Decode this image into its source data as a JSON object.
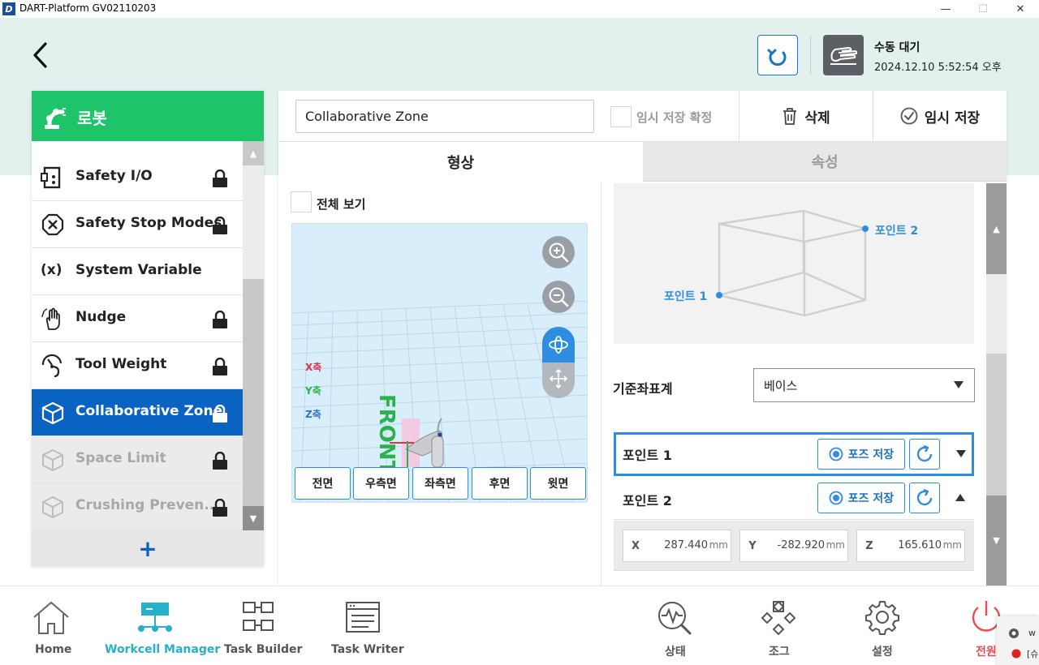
{
  "window": {
    "logo": "D",
    "title": "DART-Platform GV02110203",
    "min": "—",
    "max": "☐",
    "close": "✕"
  },
  "header": {
    "status_title": "수동 대기",
    "status_time": "2024.12.10 5:52:54 오후"
  },
  "sidebar": {
    "title": "로봇",
    "items": [
      {
        "label": "Safety I/O",
        "icon": "safety-io-icon",
        "locked": true,
        "state": "normal"
      },
      {
        "label": "Safety Stop Modes",
        "icon": "stop-mode-icon",
        "locked": true,
        "state": "normal"
      },
      {
        "label": "System Variable",
        "icon": "variable-icon",
        "locked": false,
        "state": "normal"
      },
      {
        "label": "Nudge",
        "icon": "nudge-hand-icon",
        "locked": true,
        "state": "normal"
      },
      {
        "label": "Tool Weight",
        "icon": "tool-weight-icon",
        "locked": true,
        "state": "normal"
      },
      {
        "label": "Collaborative Zone",
        "icon": "cube-icon",
        "locked": true,
        "state": "active"
      },
      {
        "label": "Space Limit",
        "icon": "cube-icon",
        "locked": true,
        "state": "disabled"
      },
      {
        "label": "Crushing Preven...",
        "icon": "cube-icon",
        "locked": true,
        "state": "disabled"
      }
    ],
    "add_label": "+",
    "variable_glyph": "(x)"
  },
  "editor": {
    "zone_name": "Collaborative Zone",
    "temp_confirm_label": "임시 저장 확정",
    "delete_label": "삭제",
    "temp_save_label": "임시 저장",
    "tabs": {
      "shape": "형상",
      "properties": "속성"
    },
    "full_view_label": "전체 보기",
    "axes": {
      "x": "X축",
      "y": "Y축",
      "z": "Z축"
    },
    "front_text": "FRONT",
    "view_buttons": [
      "전면",
      "우측면",
      "좌측면",
      "후면",
      "윗면"
    ],
    "diagram_point1": "포인트 1",
    "diagram_point2": "포인트 2",
    "coord_label": "기준좌표계",
    "coord_value": "베이스",
    "point1": {
      "label": "포인트 1",
      "pose_btn": "포즈 저장"
    },
    "point2": {
      "label": "포인트 2",
      "pose_btn": "포즈 저장",
      "x_axis": "X",
      "x_value": "287.440",
      "y_axis": "Y",
      "y_value": "-282.920",
      "z_axis": "Z",
      "z_value": "165.610",
      "unit": "mm"
    }
  },
  "bottom_nav": {
    "home": "Home",
    "workcell": "Workcell Manager",
    "task_builder": "Task Builder",
    "task_writer": "Task Writer",
    "status": "상태",
    "jog": "조그",
    "settings": "설정",
    "power": "전원"
  },
  "popup": {
    "line1": "w",
    "line2": "[슈"
  },
  "colors": {
    "accent": "#0a63c2",
    "green": "#1ec46a",
    "header_bg": "#e3f1ee",
    "highlight_blue": "#2e8de0",
    "power_red": "#e84c4c"
  }
}
